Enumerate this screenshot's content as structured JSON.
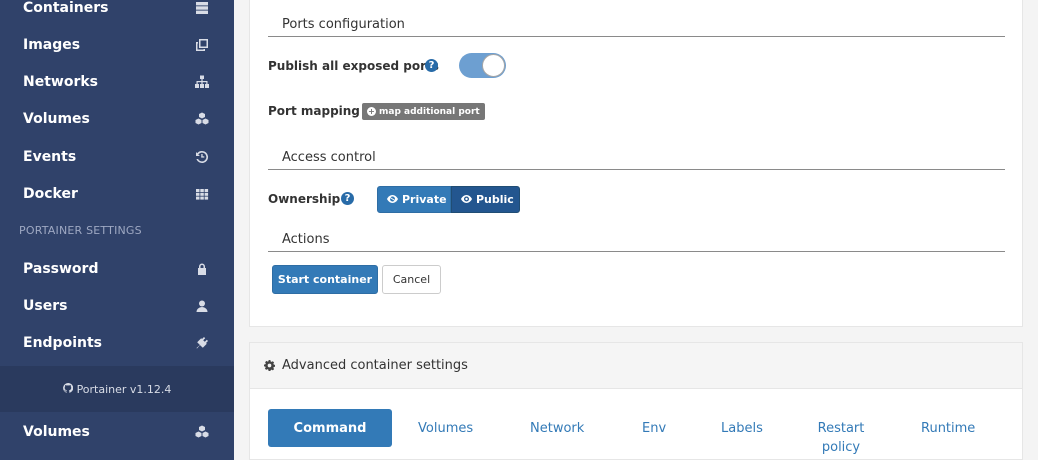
{
  "sidebar": {
    "items": [
      {
        "label": "Containers",
        "icon": "server-icon"
      },
      {
        "label": "Images",
        "icon": "clone-icon"
      },
      {
        "label": "Networks",
        "icon": "sitemap-icon"
      },
      {
        "label": "Volumes",
        "icon": "cubes-icon"
      },
      {
        "label": "Events",
        "icon": "history-icon"
      },
      {
        "label": "Docker",
        "icon": "grid-icon"
      }
    ],
    "settings_title": "PORTAINER SETTINGS",
    "settings_items": [
      {
        "label": "Password",
        "icon": "lock-icon"
      },
      {
        "label": "Users",
        "icon": "user-icon"
      },
      {
        "label": "Endpoints",
        "icon": "plug-icon"
      }
    ],
    "footer": "Portainer v1.12.4",
    "bottom_item": {
      "label": "Volumes",
      "icon": "cubes-icon"
    }
  },
  "form": {
    "ports_header": "Ports configuration",
    "publish_label": "Publish all exposed ports",
    "publish_enabled": true,
    "port_mapping_label": "Port mapping",
    "map_port_button": "map additional port",
    "access_header": "Access control",
    "ownership_label": "Ownership",
    "ownership_options": [
      "Private",
      "Public"
    ],
    "ownership_selected": "Public",
    "actions_header": "Actions",
    "start_button": "Start container",
    "cancel_button": "Cancel"
  },
  "advanced": {
    "title": "Advanced container settings",
    "tabs": [
      "Command",
      "Volumes",
      "Network",
      "Env",
      "Labels",
      "Restart policy",
      "Runtime"
    ],
    "active_tab": "Command"
  },
  "colors": {
    "sidebar_bg": "#30426a",
    "primary": "#337ab7",
    "primary_dark": "#23568f"
  }
}
